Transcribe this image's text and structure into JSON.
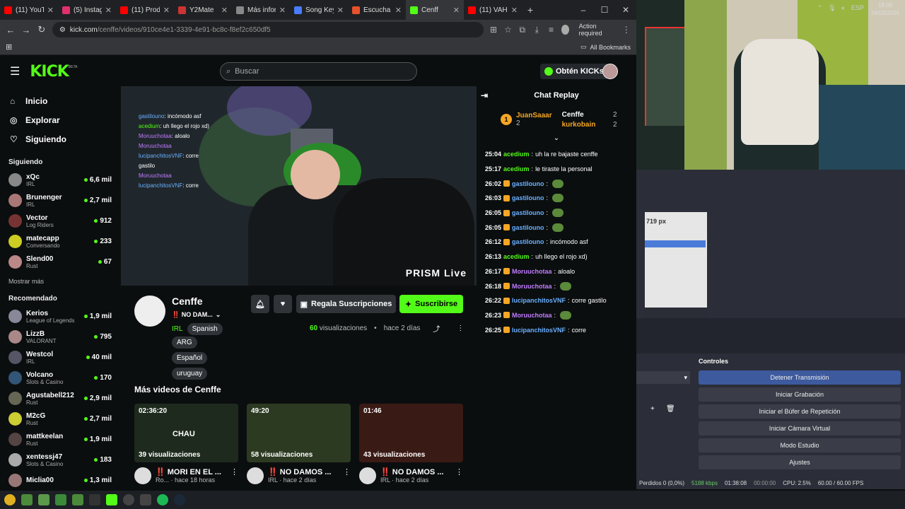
{
  "browser": {
    "tabs": [
      {
        "title": "(11) YouT",
        "color": "#ff0000"
      },
      {
        "title": "(5) Instag",
        "color": "#e1306c"
      },
      {
        "title": "(11) Prod",
        "color": "#ff0000"
      },
      {
        "title": "Y2Mate",
        "color": "#cc3333"
      },
      {
        "title": "Más infor",
        "color": "#888888"
      },
      {
        "title": "Song Key",
        "color": "#4a7cff"
      },
      {
        "title": "Escucha",
        "color": "#e6522c"
      },
      {
        "title": "Cenff",
        "color": "#53fc18"
      },
      {
        "title": "(11) VAH",
        "color": "#ff0000"
      }
    ],
    "url_host": "kick.com",
    "url_path": "/cenffe/videos/910ce4e1-3339-4e91-bc8c-f8ef2c650df5",
    "action_required": "Action required",
    "all_bookmarks": "All Bookmarks"
  },
  "kick": {
    "logo": "KICK",
    "beta": "BETA",
    "search_placeholder": "Buscar",
    "kicks_button": "Obtén KICKs",
    "nav": [
      {
        "label": "Inicio",
        "icon": "home-icon"
      },
      {
        "label": "Explorar",
        "icon": "compass-icon"
      },
      {
        "label": "Siguiendo",
        "icon": "heart-icon"
      }
    ],
    "following_title": "Siguiendo",
    "following": [
      {
        "name": "xQc",
        "cat": "IRL",
        "viewers": "6,6 mil",
        "color": "#888"
      },
      {
        "name": "Brunenger",
        "cat": "IRL",
        "viewers": "2,7 mil",
        "color": "#a77"
      },
      {
        "name": "Vector",
        "cat": "Log Riders",
        "viewers": "912",
        "color": "#733"
      },
      {
        "name": "matecapp",
        "cat": "Conversando",
        "viewers": "233",
        "color": "#cc2"
      },
      {
        "name": "Slend00",
        "cat": "Rust",
        "viewers": "67",
        "color": "#b88"
      }
    ],
    "show_more": "Mostrar más",
    "recommended_title": "Recomendado",
    "recommended": [
      {
        "name": "Kerios",
        "cat": "League of Legends",
        "viewers": "1,9 mil",
        "color": "#889"
      },
      {
        "name": "LizzB",
        "cat": "VALORANT",
        "viewers": "795",
        "color": "#a88"
      },
      {
        "name": "Westcol",
        "cat": "IRL",
        "viewers": "40 mil",
        "color": "#556"
      },
      {
        "name": "Volcano",
        "cat": "Slots & Casino",
        "viewers": "170",
        "color": "#357"
      },
      {
        "name": "Agustabell212",
        "cat": "Rust",
        "viewers": "2,9 mil",
        "color": "#665"
      },
      {
        "name": "M2cG",
        "cat": "Rust",
        "viewers": "2,7 mil",
        "color": "#cc3"
      },
      {
        "name": "mattkeelan",
        "cat": "Rust",
        "viewers": "1,9 mil",
        "color": "#544"
      },
      {
        "name": "xentessj47",
        "cat": "Slots & Casino",
        "viewers": "183",
        "color": "#aaa"
      },
      {
        "name": "Miclia00",
        "cat": "",
        "viewers": "1,3 mil",
        "color": "#977"
      }
    ]
  },
  "video": {
    "overlay_chat": [
      {
        "user": "gastilouno",
        "text": "incómodo asf",
        "ucolor": "#6ab0ff"
      },
      {
        "user": "acedium",
        "text": "uh llego el rojo xd)",
        "ucolor": "#53fc18"
      },
      {
        "user": "Moruuchotaa",
        "text": "aloalo",
        "ucolor": "#c07cff"
      },
      {
        "user": "Moruuchotaa",
        "text": "",
        "ucolor": "#c07cff"
      },
      {
        "user": "lucipanchitosVNF",
        "text": "corre gastilo",
        "ucolor": "#6ab0ff"
      },
      {
        "user": "Moruuchotaa",
        "text": "",
        "ucolor": "#c07cff"
      },
      {
        "user": "lucipanchitosVNF",
        "text": "corre",
        "ucolor": "#6ab0ff"
      }
    ],
    "watermark": "PRISM Live"
  },
  "channel": {
    "name": "Cenffe",
    "title": "‼️ NO DAM...",
    "category": "IRL",
    "language": "Spanish",
    "tags": [
      "ARG",
      "Español",
      "uruguay"
    ],
    "gift_label": "Regala Suscripciones",
    "subscribe_label": "Suscribirse",
    "views": "60",
    "views_label": "visualizaciones",
    "ago": "hace 2 días"
  },
  "more_videos": {
    "title": "Más videos de Cenffe",
    "items": [
      {
        "duration": "02:36:20",
        "views": "39 visualizaciones",
        "title": "‼️ MORI EN EL ...",
        "sub": "Ro... · hace 18 horas",
        "overlay": "CHAU"
      },
      {
        "duration": "49:20",
        "views": "58 visualizaciones",
        "title": "‼️ NO DAMOS ...",
        "sub": "IRL · hace 2 días",
        "overlay": ""
      },
      {
        "duration": "01:46",
        "views": "43 visualizaciones",
        "title": "‼️ NO DAMOS ...",
        "sub": "IRL · hace 2 días",
        "overlay": ""
      }
    ]
  },
  "chat": {
    "title": "Chat Replay",
    "leaders": [
      {
        "rank": "1",
        "name": "JuanSaaar",
        "count": "2",
        "color": "#f5a623"
      },
      {
        "name": "Cenffe",
        "count": "2",
        "color": "#ffffff"
      },
      {
        "name": "kurkobain",
        "count": "2",
        "color": "#f5a623"
      }
    ],
    "messages": [
      {
        "time": "25:04",
        "user": "acedium",
        "text": "uh la re bajaste cenffe",
        "ucolor": "#53fc18",
        "emote": false
      },
      {
        "time": "25:17",
        "user": "acedium",
        "text": "le tiraste la personal",
        "ucolor": "#53fc18",
        "emote": false
      },
      {
        "time": "26:02",
        "user": "gastilouno",
        "text": "",
        "ucolor": "#6ab0ff",
        "emote": true
      },
      {
        "time": "26:03",
        "user": "gastilouno",
        "text": "",
        "ucolor": "#6ab0ff",
        "emote": true
      },
      {
        "time": "26:05",
        "user": "gastilouno",
        "text": "",
        "ucolor": "#6ab0ff",
        "emote": true
      },
      {
        "time": "26:05",
        "user": "gastilouno",
        "text": "",
        "ucolor": "#6ab0ff",
        "emote": true
      },
      {
        "time": "26:12",
        "user": "gastilouno",
        "text": "incómodo asf",
        "ucolor": "#6ab0ff",
        "emote": false
      },
      {
        "time": "26:13",
        "user": "acedium",
        "text": "uh llego el rojo xd)",
        "ucolor": "#53fc18",
        "emote": false
      },
      {
        "time": "26:17",
        "user": "Moruuchotaa",
        "text": "aloalo",
        "ucolor": "#c07cff",
        "emote": false
      },
      {
        "time": "26:18",
        "user": "Moruuchotaa",
        "text": "",
        "ucolor": "#c07cff",
        "emote": true
      },
      {
        "time": "26:22",
        "user": "lucipanchitosVNF",
        "text": "corre gastilo",
        "ucolor": "#6ab0ff",
        "emote": false
      },
      {
        "time": "26:23",
        "user": "Moruuchotaa",
        "text": "",
        "ucolor": "#c07cff",
        "emote": true
      },
      {
        "time": "26:25",
        "user": "lucipanchitosVNF",
        "text": "corre",
        "ucolor": "#6ab0ff",
        "emote": false
      }
    ]
  },
  "obs": {
    "preview_size": "719 px",
    "controls_title": "Controles",
    "buttons": [
      "Detener Transmisión",
      "Iniciar Grabación",
      "Iniciar el Búfer de Repetición",
      "Iniciar Cámara Virtual",
      "Modo Estudio",
      "Ajustes"
    ],
    "status": {
      "dropped": "Perdidos 0 (0,0%)",
      "bitrate": "5188 kbps",
      "live": "01:38:08",
      "rec": "00:00:00",
      "cpu": "CPU: 2.5%",
      "fps": "60.00 / 60.00 FPS"
    }
  },
  "taskbar": {
    "time": "18:09",
    "date": "24/03/2026",
    "lang": "ESP"
  }
}
